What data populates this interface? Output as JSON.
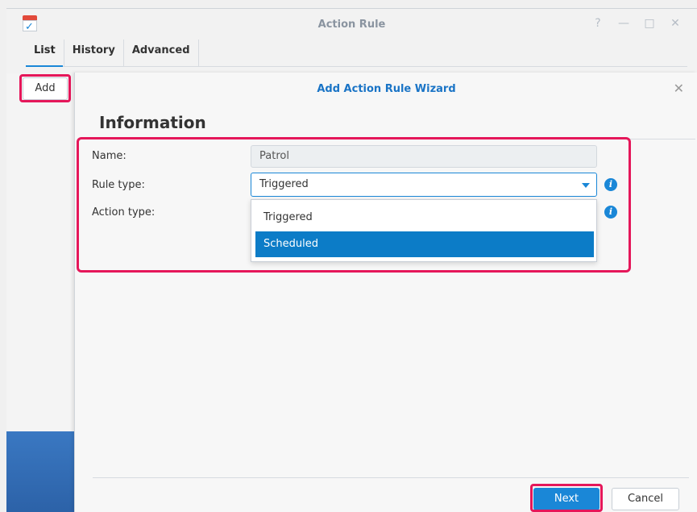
{
  "window": {
    "title": "Action Rule",
    "controls": [
      "?",
      "—",
      "□",
      "✕"
    ]
  },
  "tabs": [
    {
      "label": "List"
    },
    {
      "label": "History"
    },
    {
      "label": "Advanced"
    }
  ],
  "toolbar": {
    "add_label": "Add"
  },
  "wizard": {
    "title": "Add Action Rule Wizard",
    "close_label": "✕",
    "section_heading": "Information",
    "fields": {
      "name_label": "Name:",
      "name_value": "Patrol",
      "rule_type_label": "Rule type:",
      "rule_type_value": "Triggered",
      "action_type_label": "Action type:"
    },
    "dropdown_options": [
      "Triggered",
      "Scheduled"
    ],
    "next_label": "Next",
    "cancel_label": "Cancel"
  },
  "colors": {
    "accent": "#1a87d7",
    "highlight": "#e5175a",
    "selected_option": "#0c7cc7"
  }
}
